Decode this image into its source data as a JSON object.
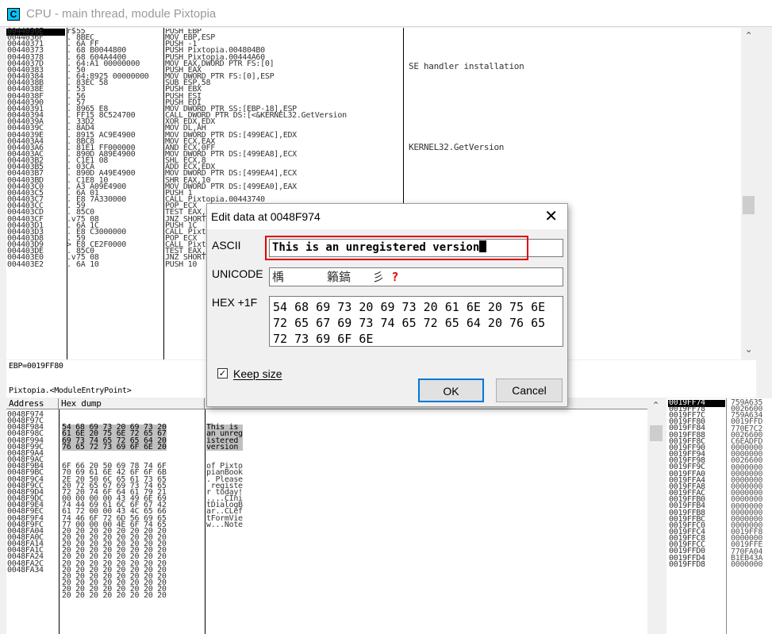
{
  "window": {
    "icon_glyph": "C",
    "title": "CPU - main thread, module Pixtopia"
  },
  "disasm": {
    "addresses": "0044036E\n0044036F\n00440371\n00440373\n00440378\n0044037D\n00440383\n00440384\n0044038B\n0044038E\n0044038F\n00440390\n00440391\n00440394\n0044039A\n0044039C\n0044039E\n004403A4\n004403A6\n004403AC\n004403B2\n004403B5\n004403B7\n004403BD\n004403C0\n004403C5\n004403C7\n004403CC\n004403CD\n004403CF\n004403D1\n004403D3\n004403D8\n004403D9\n004403DE\n004403E0\n004403E2",
    "gutter": "r$\n.\n.\n.\n.\n.\n.\n.\n.\n.\n.\n.\n.\n.\n.\n.\n.\n.\n.\n.\n.\n.\n.\n.\n.\n.\n.\n.\n.\n.v\n.\n.\n.\n>\n.\n.v\n.",
    "bytes": "55\n8BEC\n6A FF\n68 B0044800\n68 604A4400\n64:A1 00000000\n50\n64:8925 00000000\n83EC 58\n53\n56\n57\n8965 E8\nFF15 8C524700\n33D2\n8AD4\n8915 AC9E4900\n8BC8\n81E1 FF000000\n890D A89E4900\nC1E1 08\n03CA\n890D A49E4900\nC1E8 10\nA3 A09E4900\n6A 01\nE8 7A330000\n59\n85C0\n75 08\n6A 1C\nE8 C3000000\n59\nE8 CE2F0000\n85C0\n75 08\n6A 10",
    "instructions": "PUSH EBP\nMOV EBP,ESP\nPUSH -1\nPUSH Pixtopia.004804B0\nPUSH Pixtopia.00444A60\nMOV EAX,DWORD PTR FS:[0]\nPUSH EAX\nMOV DWORD PTR FS:[0],ESP\nSUB ESP,58\nPUSH EBX\nPUSH ESI\nPUSH EDI\nMOV DWORD PTR SS:[EBP-18],ESP\nCALL DWORD PTR DS:[<&KERNEL32.GetVersion\nXOR EDX,EDX\nMOV DL,AH\nMOV DWORD PTR DS:[499EAC],EDX\nMOV ECX,EAX\nAND ECX,0FF\nMOV DWORD PTR DS:[499EA8],ECX\nSHL ECX,8\nADD ECX,EDX\nMOV DWORD PTR DS:[499EA4],ECX\nSHR EAX,10\nMOV DWORD PTR DS:[499EA0],EAX\nPUSH 1\nCALL Pixtopia.00443740\nPOP ECX\nTEST EAX,EAX\nJNZ SHORT Pixtopia.004403D9\nPUSH 1C\nCALL Pixtopia.0044049B\nPOP ECX\nCALL Pixtopia.004433AC\nTEST EAX,EAX\nJNZ SHORT Pixtopia.004403EA\nPUSH 10",
    "comment_se": "SE handler installation",
    "comment_kernel": "KERNEL32.GetVersion"
  },
  "info": {
    "line1": "EBP=0019FF80",
    "line2": "Pixtopia.<ModuleEntryPoint>"
  },
  "dump": {
    "header_address": "Address",
    "header_hex": "Hex dump",
    "header_ascii": "ASCII",
    "addresses": "0048F974\n0048F97C\n0048F984\n0048F98C\n0048F994\n0048F99C\n0048F9A4\n0048F9AC\n0048F9B4\n0048F9BC\n0048F9C4\n0048F9CC\n0048F9D4\n0048F9DC\n0048F9E4\n0048F9EC\n0048F9F4\n0048F9FC\n0048FA04\n0048FA0C\n0048FA14\n0048FA1C\n0048FA24\n0048FA2C\n0048FA34",
    "hex_selected": "54 68 69 73 20 69 73 20\n61 6E 20 75 6E 72 65 67\n69 73 74 65 72 65 64 20\n76 65 72 73 69 6F 6E 20",
    "hex_rest": "6F 66 20 50 69 78 74 6F\n70 69 61 6E 42 6F 6F 6B\n2E 20 50 6C 65 61 73 65\n20 72 65 67 69 73 74 65\n72 20 74 6F 64 61 79 21\n00 00 00 00 43 49 6E 69\n74 44 69 61 6C 6F 67 42\n61 72 00 00 43 4C 65 66\n74 46 6F 72 6D 56 69 65\n77 00 00 00 4E 6F 74 65\n20 20 20 20 20 20 20 20\n20 20 20 20 20 20 20 20\n20 20 20 20 20 20 20 20\n20 20 20 20 20 20 20 20\n20 20 20 20 20 20 20 20\n20 20 20 20 20 20 20 20\n20 20 20 20 20 20 20 20\n20 20 20 20 20 20 20 20\n20 20 20 20 20 20 20 20\n20 20 20 20 20 20 20 20\n20 20 20 20 20 20 20 20",
    "ascii_selected": "This is \nan unreg\nistered \nversion ",
    "ascii_rest": "of Pixto\npianBook\n. Please\n registe\nr today!\n....CIni\ntDialogB\nar..CLef\ntFormVie\nw...Note"
  },
  "stack": {
    "addresses_top": "0019FF74",
    "addresses": "0019FF78\n0019FF7C\n0019FF80\n0019FF84\n0019FF88\n0019FF8C\n0019FF90\n0019FF94\n0019FF98\n0019FF9C\n0019FFA0\n0019FFA4\n0019FFA8\n0019FFAC\n0019FFB0\n0019FFB4\n0019FFB8\n0019FFBC\n0019FFC0\n0019FFC4\n0019FFC8\n0019FFCC\n0019FFD0\n0019FFD4\n0019FFD8",
    "values": "759A635\n0026600\n759A634\n0019FFD\n770E7C2\n0026600\nC6EADFD\n0000000\n0000000\n0026600\n0000000\n0000000\n0000000\n0000000\n0000000\n0000000\n0000000\n0000000\n0000000\n0000000\n0019FF8\n0000000\n0019FFE\n770FA04\nB1EB43A\n0000000"
  },
  "dialog": {
    "title": "Edit data at 0048F974",
    "close_glyph": "✕",
    "ascii_label": "ASCII",
    "ascii_value": "This is an unregistered version",
    "unicode_label": "UNICODE",
    "unicode_value": "楀      籟鎬   彡 ",
    "unicode_unknown": "?",
    "hex_label": "HEX +1F",
    "hex_value": "54 68 69 73 20 69 73 20 61 6E 20 75 6E 72 65 67 69 73 74 65 72 65 64 20 76 65 72 73 69 6F 6E",
    "keep_size_label": "Keep size",
    "keep_size_checked": true,
    "ok_label": "OK",
    "cancel_label": "Cancel"
  }
}
